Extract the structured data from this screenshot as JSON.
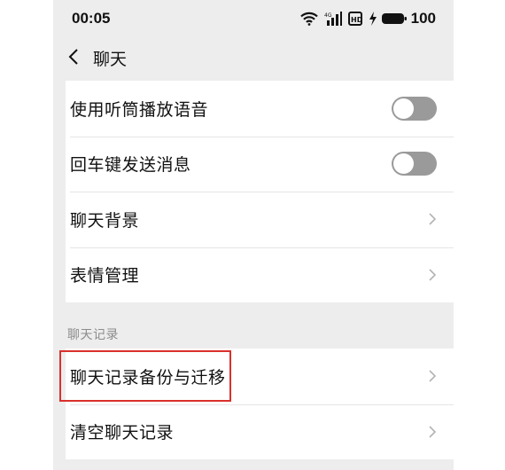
{
  "status_bar": {
    "time": "00:05",
    "battery_level": "100",
    "icons": [
      "wifi-icon",
      "signal-icon",
      "hd-icon",
      "charging-icon",
      "battery-icon"
    ]
  },
  "nav": {
    "title": "聊天",
    "back_icon": "chevron-left-icon"
  },
  "settings_group_1": [
    {
      "label": "使用听筒播放语音",
      "control": "toggle",
      "state": "off"
    },
    {
      "label": "回车键发送消息",
      "control": "toggle",
      "state": "off"
    },
    {
      "label": "聊天背景",
      "control": "chevron"
    },
    {
      "label": "表情管理",
      "control": "chevron"
    }
  ],
  "chat_history_section": {
    "title": "聊天记录",
    "items": [
      {
        "label": "聊天记录备份与迁移",
        "control": "chevron",
        "highlighted": true
      },
      {
        "label": "清空聊天记录",
        "control": "chevron"
      }
    ]
  },
  "colors": {
    "background": "#ededed",
    "card": "#ffffff",
    "toggle_off": "#9a9a9a",
    "highlight": "#d9302c"
  }
}
